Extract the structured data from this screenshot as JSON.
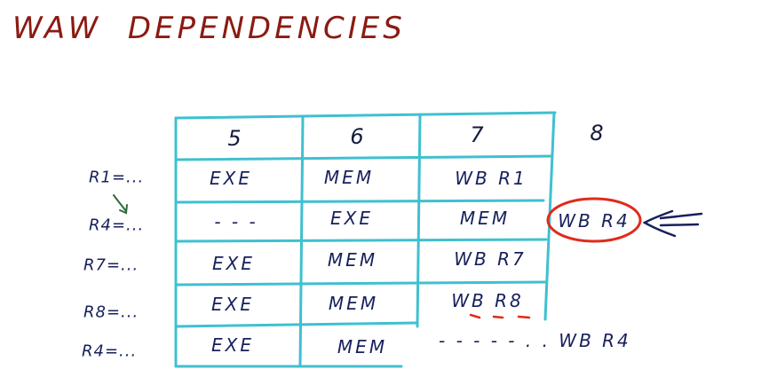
{
  "title": "WAW  DEPENDENCIES",
  "columns": [
    "5",
    "6",
    "7",
    "8"
  ],
  "rows": [
    {
      "label": "R1=...",
      "cells": [
        "EXE",
        "MEM",
        "WB R1"
      ]
    },
    {
      "label": "R4=...",
      "cells": [
        "- - -",
        "EXE",
        "MEM",
        "WB R4"
      ]
    },
    {
      "label": "R7=...",
      "cells": [
        "EXE",
        "MEM",
        "WB R7"
      ]
    },
    {
      "label": "R8=...",
      "cells": [
        "EXE",
        "MEM",
        "WB R8"
      ]
    },
    {
      "label": "R4=...",
      "cells": [
        "EXE",
        "MEM"
      ],
      "trailing": "- - -   - - . .   WB R4"
    }
  ],
  "colors": {
    "title": "#8b1a12",
    "grid": "#3fc0d0",
    "text": "#17205c",
    "highlight": "#e02a1c",
    "arrow": "#2f6a3a"
  }
}
